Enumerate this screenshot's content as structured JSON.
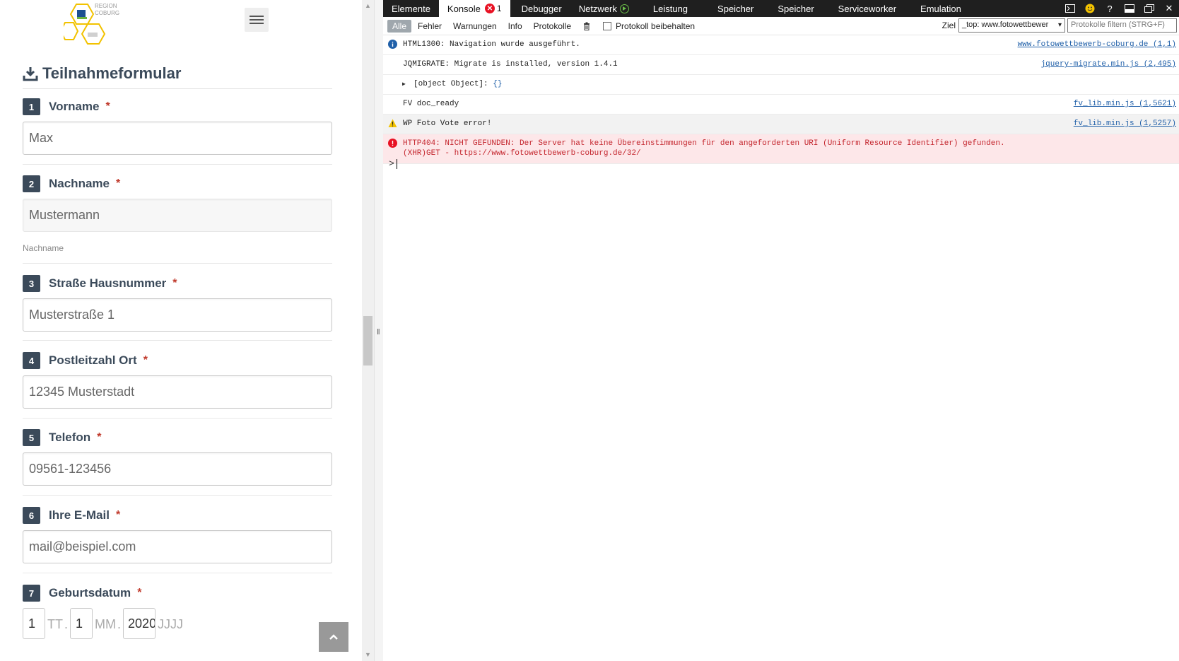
{
  "page": {
    "logo_text_line1": "REGION",
    "logo_text_line2": "COBURG",
    "form_title": "Teilnahmeformular",
    "fields": [
      {
        "num": "1",
        "label": "Vorname",
        "required": "*",
        "value": "Max"
      },
      {
        "num": "2",
        "label": "Nachname",
        "required": "*",
        "value": "Mustermann",
        "help": "Nachname"
      },
      {
        "num": "3",
        "label": "Straße Hausnummer",
        "required": "*",
        "value": "Musterstraße 1"
      },
      {
        "num": "4",
        "label": "Postleitzahl Ort",
        "required": "*",
        "value": "12345 Musterstadt"
      },
      {
        "num": "5",
        "label": "Telefon",
        "required": "*",
        "value": "09561-123456"
      },
      {
        "num": "6",
        "label": "Ihre E-Mail",
        "required": "*",
        "value": "mail@beispiel.com"
      },
      {
        "num": "7",
        "label": "Geburtsdatum",
        "required": "*"
      }
    ],
    "date": {
      "day": "1",
      "day_hint": "TT",
      "month": "1",
      "month_hint": "MM",
      "year": "2020",
      "year_hint": "JJJJ",
      "sep": "."
    }
  },
  "devtools": {
    "tabs": [
      {
        "label": "Elemente"
      },
      {
        "label": "Konsole",
        "error_count": "1",
        "error_glyph": "✕"
      },
      {
        "label": "Debugger"
      },
      {
        "label": "Netzwerk"
      },
      {
        "label": "Leistung"
      },
      {
        "label": "Speicher"
      },
      {
        "label": "Speicher"
      },
      {
        "label": "Serviceworker"
      },
      {
        "label": "Emulation"
      }
    ],
    "toolbar_icons": {
      "help": "?",
      "close": "✕",
      "smiley": "🙂"
    },
    "filters": [
      "Alle",
      "Fehler",
      "Warnungen",
      "Info",
      "Protokolle"
    ],
    "preserve_log": "Protokoll beibehalten",
    "target_label": "Ziel",
    "target_value": "_top: www.fotowettbewer",
    "filter_placeholder": "Protokolle filtern (STRG+F)",
    "messages": [
      {
        "type": "info",
        "text": "HTML1300: Navigation wurde ausgeführt.",
        "source": "www.fotowettbewerb-coburg.de (1,1)"
      },
      {
        "type": "log",
        "text": "JQMIGRATE: Migrate is installed, version 1.4.1",
        "source": "jquery-migrate.min.js (2,495)"
      },
      {
        "type": "object",
        "text": "[object Object]: ",
        "object_preview": "{}"
      },
      {
        "type": "log",
        "text": "FV doc_ready",
        "source": "fv_lib.min.js (1,5621)"
      },
      {
        "type": "warning",
        "text": "WP Foto Vote error!",
        "source": "fv_lib.min.js (1,5257)"
      },
      {
        "type": "error",
        "text": "HTTP404: NICHT GEFUNDEN: Der Server hat keine Übereinstimmungen für den angeforderten URI (Uniform Resource Identifier) gefunden.",
        "text2": "(XHR)GET - https://www.fotowettbewerb-coburg.de/32/"
      }
    ],
    "prompt": ">"
  },
  "colors": {
    "heading": "#3b4a5a",
    "required": "#c0392b",
    "devtools_bar": "#1f1f1f",
    "error_bg": "#fde7e9",
    "error_text": "#c4262e",
    "link": "#1f5fa8"
  }
}
